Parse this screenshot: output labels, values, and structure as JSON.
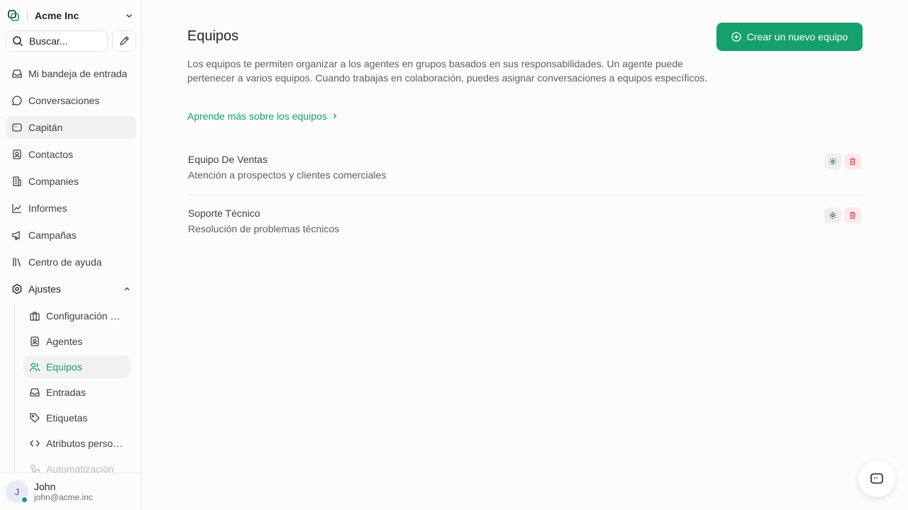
{
  "workspace": {
    "name": "Acme Inc"
  },
  "search": {
    "placeholder": "Buscar..."
  },
  "sidebar": {
    "items": [
      {
        "label": "Mi bandeja de entrada",
        "icon": "inbox-icon"
      },
      {
        "label": "Conversaciones",
        "icon": "chat-bubble-icon"
      },
      {
        "label": "Capitán",
        "icon": "captain-icon"
      },
      {
        "label": "Contactos",
        "icon": "contact-card-icon"
      },
      {
        "label": "Companies",
        "icon": "building-icon"
      },
      {
        "label": "Informes",
        "icon": "chart-line-icon"
      },
      {
        "label": "Campañas",
        "icon": "megaphone-icon"
      },
      {
        "label": "Centro de ayuda",
        "icon": "library-icon"
      }
    ],
    "settings_label": "Ajustes",
    "sub_items": [
      {
        "label": "Configuración de la cuenta",
        "icon": "briefcase-icon"
      },
      {
        "label": "Agentes",
        "icon": "contact-card-icon"
      },
      {
        "label": "Equipos",
        "icon": "users-icon"
      },
      {
        "label": "Entradas",
        "icon": "inbox-icon"
      },
      {
        "label": "Etiquetas",
        "icon": "tag-icon"
      },
      {
        "label": "Atributos personalizados",
        "icon": "code-icon"
      },
      {
        "label": "Automatización",
        "icon": "automation-icon"
      }
    ]
  },
  "user": {
    "initial": "J",
    "name": "John",
    "email": "john@acme.inc"
  },
  "page": {
    "title": "Equipos",
    "create_button": "Crear un nuevo equipo",
    "description": "Los equipos te permiten organizar a los agentes en grupos basados en sus responsabilidades. Un agente puede pertenecer a varios equipos. Cuando trabajas en colaboración, puedes asignar conversaciones a equipos específicos.",
    "learn_more": "Aprende más sobre los equipos"
  },
  "teams": [
    {
      "name": "Equipo De Ventas",
      "description": "Atención a prospectos y clientes comerciales"
    },
    {
      "name": "Soporte Técnico",
      "description": "Resolución de problemas técnicos"
    }
  ],
  "colors": {
    "accent": "#16a06b",
    "danger": "#e2485a"
  }
}
